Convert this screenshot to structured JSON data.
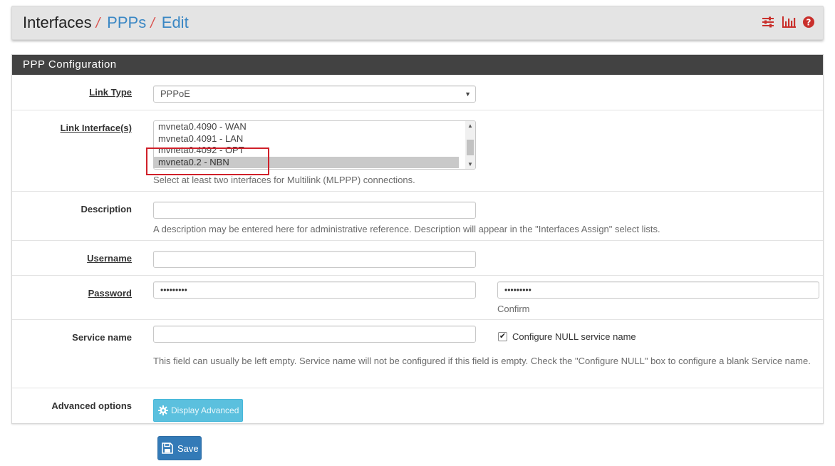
{
  "breadcrumb": {
    "items": [
      "Interfaces",
      "PPPs",
      "Edit"
    ],
    "separator": "/"
  },
  "header_icons": [
    "sliders-icon",
    "bar-chart-icon",
    "help-icon"
  ],
  "panel": {
    "title": "PPP Configuration"
  },
  "form": {
    "link_type": {
      "label": "Link Type",
      "value": "PPPoE"
    },
    "link_interfaces": {
      "label": "Link Interface(s)",
      "options": [
        "mvneta0.4090 - WAN",
        "mvneta0.4091 - LAN",
        "mvneta0.4092 - OPT",
        "mvneta0.2 - NBN"
      ],
      "selected": "mvneta0.2 - NBN",
      "help": "Select at least two interfaces for Multilink (MLPPP) connections."
    },
    "description": {
      "label": "Description",
      "value": "",
      "help": "A description may be entered here for administrative reference. Description will appear in the \"Interfaces Assign\" select lists."
    },
    "username": {
      "label": "Username",
      "value": ""
    },
    "password": {
      "label": "Password",
      "value": "•••••••••",
      "confirm_value": "•••••••••",
      "confirm_label": "Confirm"
    },
    "service_name": {
      "label": "Service name",
      "value": "",
      "null_checkbox_label": "Configure NULL service name",
      "null_checked": true,
      "help": "This field can usually be left empty. Service name will not be configured if this field is empty. Check the \"Configure NULL\" box to configure a blank Service name."
    },
    "advanced": {
      "label": "Advanced options",
      "button_label": "Display Advanced"
    }
  },
  "save_label": "Save",
  "colors": {
    "header_bg": "#e4e4e4",
    "panel_heading_bg": "#424242",
    "link_blue": "#3a87c4",
    "separator_red": "#d9534f",
    "info_button": "#5bc0de",
    "primary_button": "#337ab7",
    "annotation_red": "#d0202a"
  }
}
